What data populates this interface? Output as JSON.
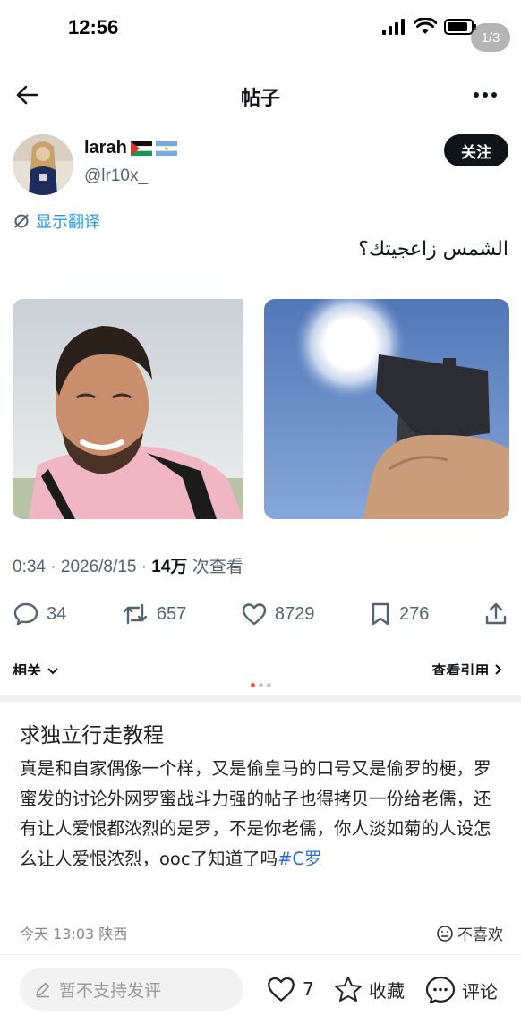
{
  "status_bar": {
    "time": "12:56",
    "page_counter": "1/3",
    "icons": [
      "signal-icon",
      "wifi-icon",
      "battery-icon"
    ]
  },
  "nav": {
    "title": "帖子",
    "back_icon": "arrow-left-icon",
    "more_icon": "more-icon"
  },
  "author": {
    "name": "larah",
    "flags": [
      "palestine-flag",
      "argentina-flag"
    ],
    "handle": "@lr10x_",
    "follow_label": "关注"
  },
  "translate": {
    "label": "显示翻译"
  },
  "post": {
    "text": "الشمس زاعجيتك؟",
    "images": [
      "smiling-man-photo",
      "hand-holding-pistol-sun-photo"
    ]
  },
  "meta": {
    "time": "0:34",
    "separator": "·",
    "date": "2026/8/15",
    "views_count": "14万",
    "views_label": "次查看"
  },
  "actions": {
    "replies": "34",
    "reposts": "657",
    "likes": "8729",
    "bookmarks": "276"
  },
  "related": {
    "left": "相关",
    "right": "查看引用"
  },
  "pager": {
    "total": 3,
    "active": 0
  },
  "comment": {
    "title": "求独立行走教程",
    "body": "真是和自家偶像一个样，又是偷皇马的口号又是偷罗的梗，罗蜜发的讨论外网罗蜜战斗力强的帖子也得拷贝一份给老儒，还有让人爱恨都浓烈的是罗，不是你老儒，你人淡如菊的人设怎么让人爱恨浓烈，ooc了知道了吗",
    "tag": "#C罗",
    "meta": "今天 13:03 陕西",
    "dislike_label": "不喜欢"
  },
  "bottom_bar": {
    "input_placeholder": "暂不支持发评",
    "likes": "7",
    "collect_label": "收藏",
    "comment_label": "评论"
  },
  "colors": {
    "accent_blue": "#1d9bf0",
    "text_primary": "#0f1419",
    "text_secondary": "#536471",
    "tag_blue": "#2e6bd6",
    "pager_active": "#ff4c4c"
  }
}
